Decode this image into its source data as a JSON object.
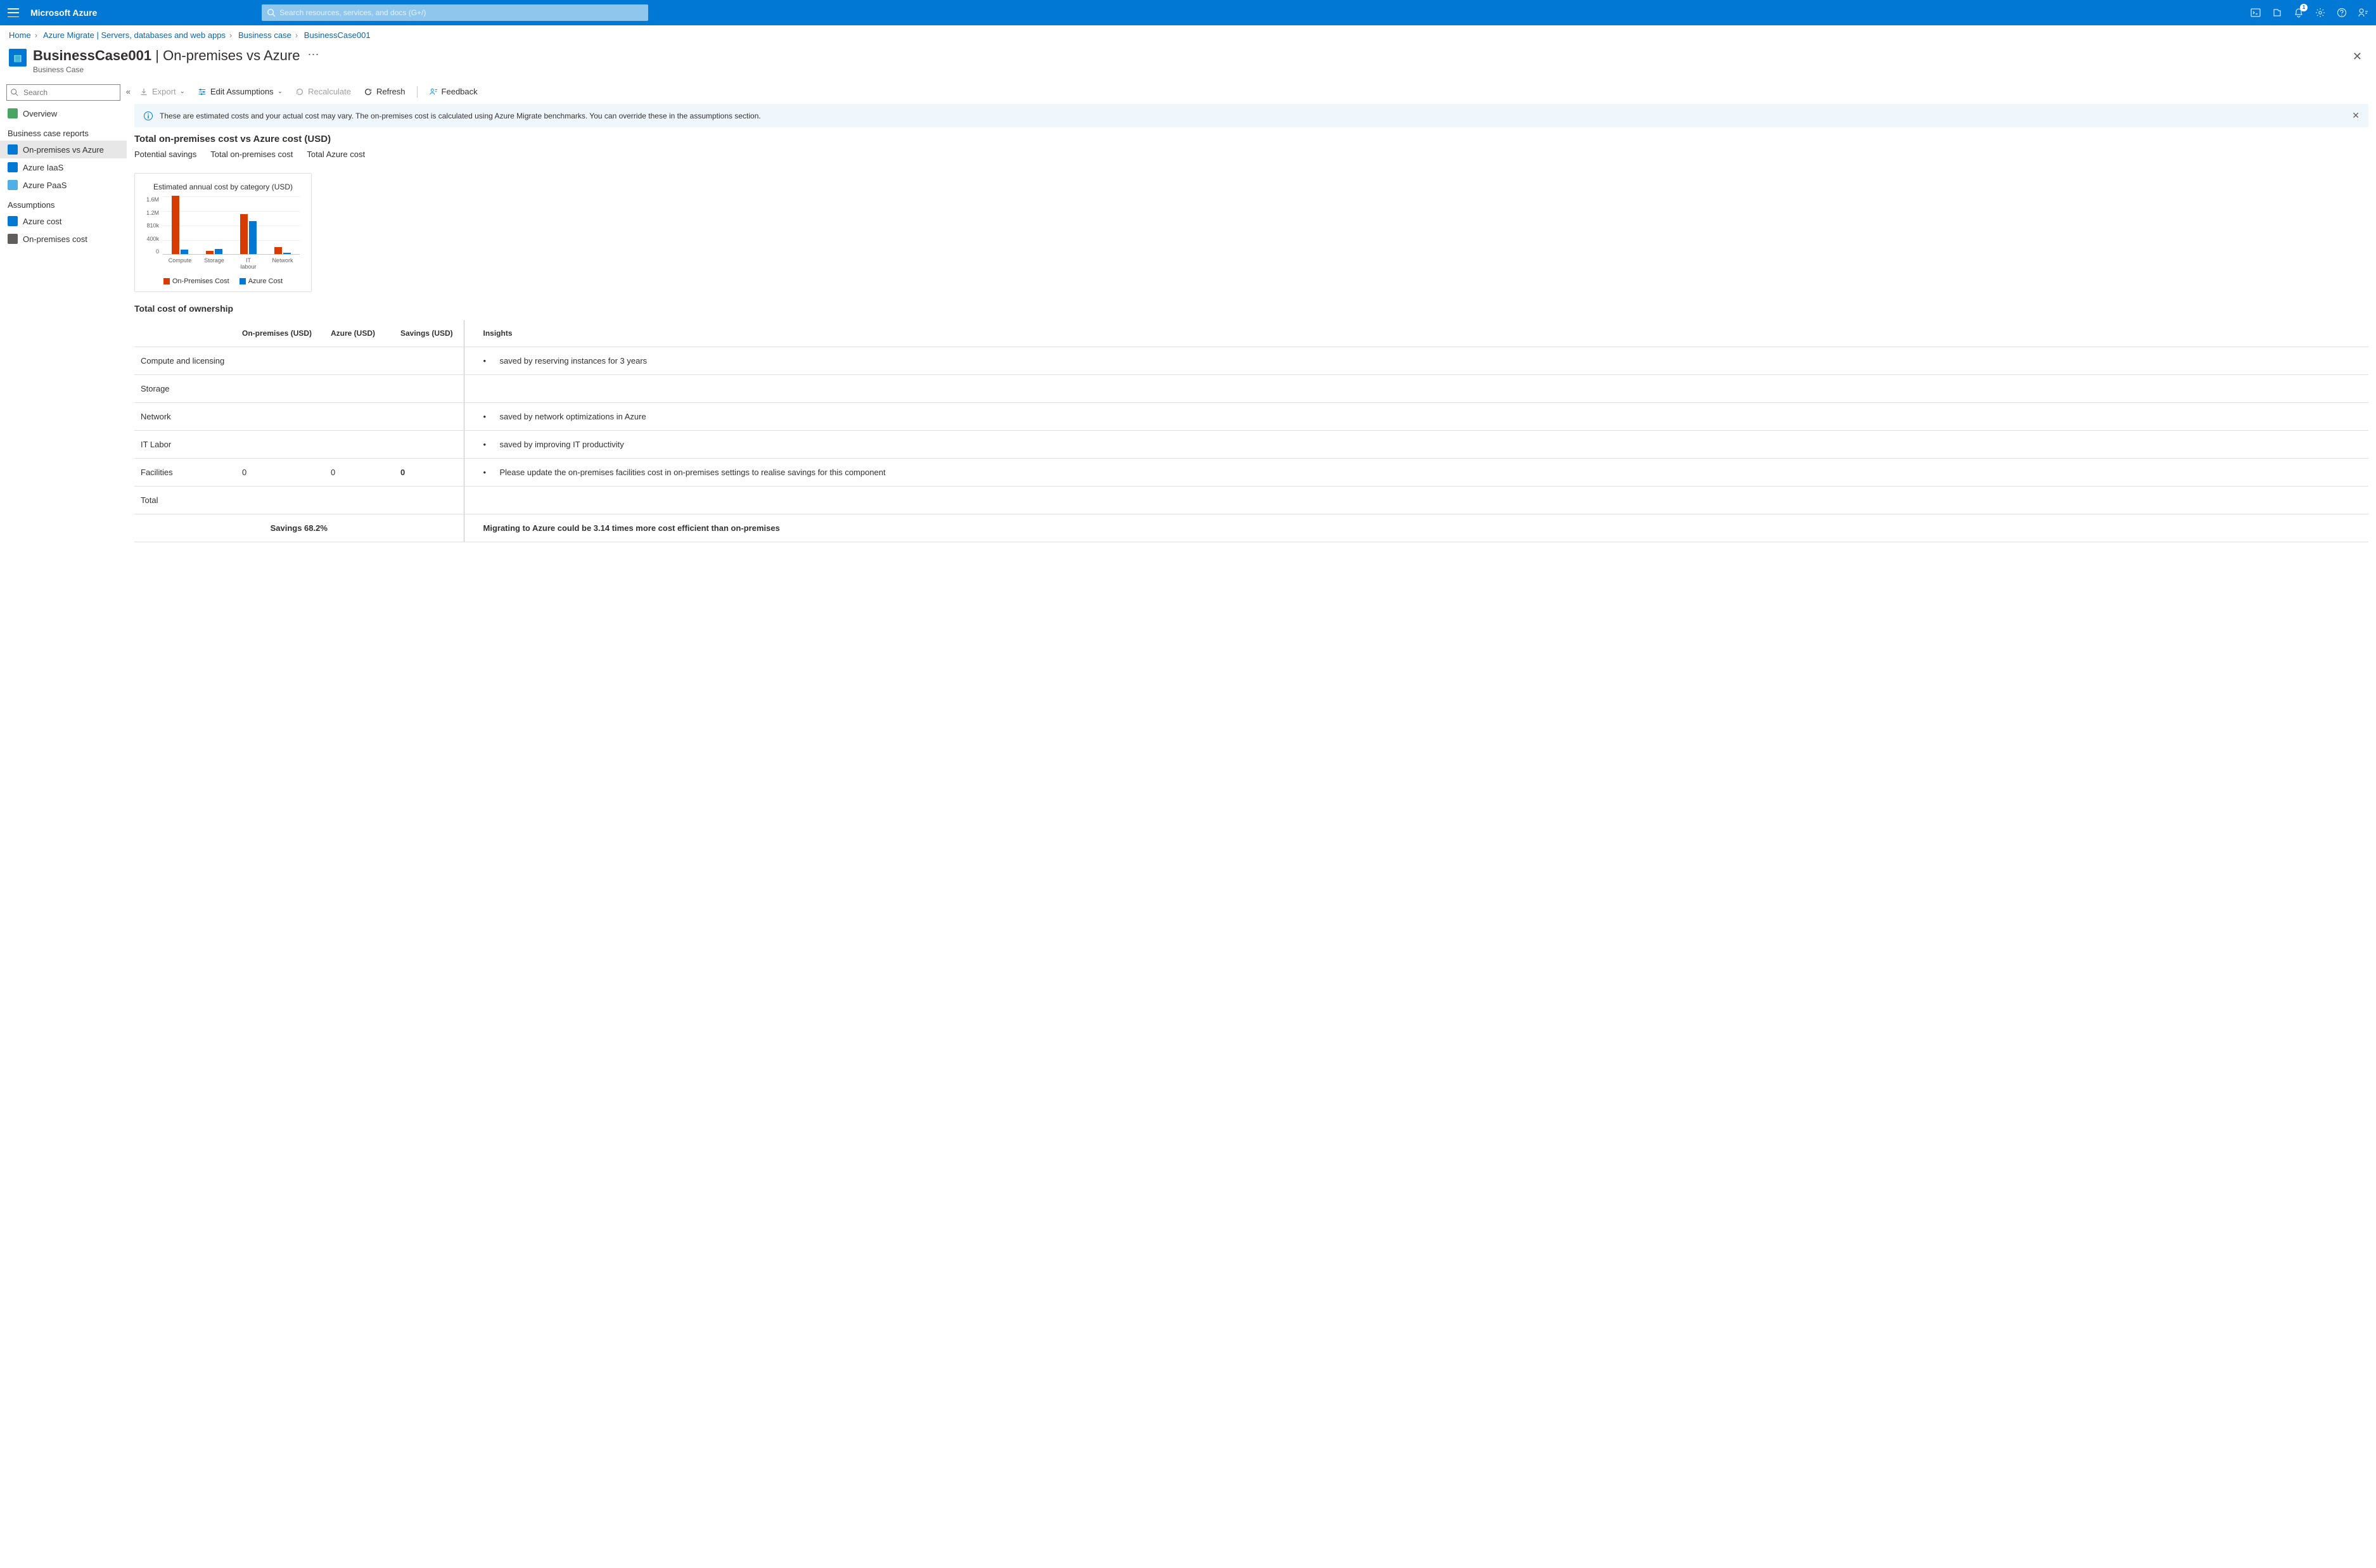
{
  "header": {
    "brand": "Microsoft Azure",
    "search_placeholder": "Search resources, services, and docs (G+/)",
    "notification_count": "1"
  },
  "breadcrumbs": [
    "Home",
    "Azure Migrate | Servers, databases and web apps",
    "Business case",
    "BusinessCase001"
  ],
  "title": {
    "name": "BusinessCase001",
    "suffix": "On-premises vs Azure",
    "subtitle": "Business Case"
  },
  "sidebar": {
    "search_placeholder": "Search",
    "overview": "Overview",
    "section_reports": "Business case reports",
    "reports": [
      "On-premises vs Azure",
      "Azure IaaS",
      "Azure PaaS"
    ],
    "section_assumptions": "Assumptions",
    "assumptions": [
      "Azure cost",
      "On-premises cost"
    ]
  },
  "toolbar": {
    "export": "Export",
    "edit": "Edit Assumptions",
    "recalc": "Recalculate",
    "refresh": "Refresh",
    "feedback": "Feedback"
  },
  "infobar": "These are estimated costs and your actual cost may vary. The on-premises cost is calculated using Azure Migrate benchmarks. You can override these in the assumptions section.",
  "section_title": "Total on-premises cost vs Azure cost (USD)",
  "tabs": [
    "Potential savings",
    "Total on-premises cost",
    "Total Azure cost"
  ],
  "chart_data": {
    "type": "bar",
    "title": "Estimated annual cost by category (USD)",
    "categories": [
      "Compute",
      "Storage",
      "IT labour",
      "Network"
    ],
    "ylabels": [
      "1.6M",
      "1.2M",
      "810k",
      "400k",
      "0"
    ],
    "ylim": [
      0,
      1600000
    ],
    "series": [
      {
        "name": "On-Premises Cost",
        "color": "#d83b01",
        "values": [
          1600000,
          90000,
          1100000,
          200000
        ]
      },
      {
        "name": "Azure Cost",
        "color": "#0078d4",
        "values": [
          120000,
          140000,
          900000,
          30000
        ]
      }
    ]
  },
  "tco": {
    "title": "Total cost of ownership",
    "headers": [
      "",
      "On-premises (USD)",
      "Azure (USD)",
      "Savings (USD)",
      "Insights"
    ],
    "rows": [
      {
        "label": "Compute and licensing",
        "onprem": "",
        "azure": "",
        "savings": "",
        "insight": "saved by reserving instances for 3 years"
      },
      {
        "label": "Storage",
        "onprem": "",
        "azure": "",
        "savings": "",
        "insight": ""
      },
      {
        "label": "Network",
        "onprem": "",
        "azure": "",
        "savings": "",
        "insight": "saved by network optimizations in Azure"
      },
      {
        "label": "IT Labor",
        "onprem": "",
        "azure": "",
        "savings": "",
        "insight": "saved by improving IT productivity"
      },
      {
        "label": "Facilities",
        "onprem": "0",
        "azure": "0",
        "savings": "0",
        "insight": "Please update the on-premises facilities cost in on-premises settings to realise savings for this component"
      },
      {
        "label": "Total",
        "onprem": "",
        "azure": "",
        "savings": "",
        "insight": ""
      }
    ],
    "footer_savings": "Savings 68.2%",
    "footer_insight": "Migrating to Azure could be 3.14 times more cost efficient than on-premises"
  }
}
